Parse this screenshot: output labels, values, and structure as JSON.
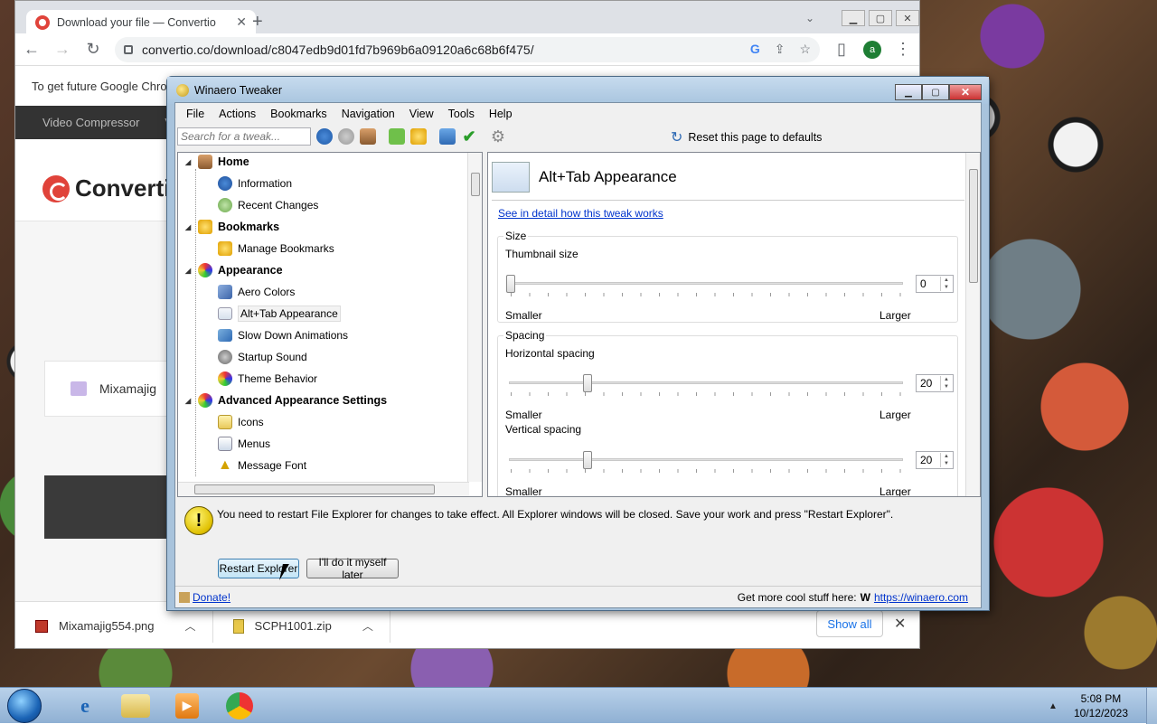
{
  "chrome": {
    "tab_title": "Download your file — Convertio",
    "tab_close": "✕",
    "new_tab": "+",
    "tab_menu": "⌄",
    "url": "convertio.co/download/c8047edb9d01fd7b969b6a09120a6c68b6f475/",
    "avatar_letter": "a",
    "notice": "To get future Google Chro",
    "site_nav": [
      "Video Compressor",
      "Vi"
    ],
    "logo_text": "Convertio",
    "file_card_name": "Mixamajig",
    "downloads": [
      {
        "name": "Mixamajig554.png"
      },
      {
        "name": "SCPH1001.zip"
      }
    ],
    "show_all": "Show all",
    "close": "✕"
  },
  "winaero": {
    "title": "Winaero Tweaker",
    "menu": [
      "File",
      "Actions",
      "Bookmarks",
      "Navigation",
      "View",
      "Tools",
      "Help"
    ],
    "search_placeholder": "Search for a tweak...",
    "reset_label": "Reset this page to defaults",
    "tree": [
      {
        "label": "Home",
        "level": 0
      },
      {
        "label": "Information",
        "level": 1
      },
      {
        "label": "Recent Changes",
        "level": 1
      },
      {
        "label": "Bookmarks",
        "level": 0
      },
      {
        "label": "Manage Bookmarks",
        "level": 1
      },
      {
        "label": "Appearance",
        "level": 0
      },
      {
        "label": "Aero Colors",
        "level": 1
      },
      {
        "label": "Alt+Tab Appearance",
        "level": 1,
        "selected": true
      },
      {
        "label": "Slow Down Animations",
        "level": 1
      },
      {
        "label": "Startup Sound",
        "level": 1
      },
      {
        "label": "Theme Behavior",
        "level": 1
      },
      {
        "label": "Advanced Appearance Settings",
        "level": 0
      },
      {
        "label": "Icons",
        "level": 1
      },
      {
        "label": "Menus",
        "level": 1
      },
      {
        "label": "Message Font",
        "level": 1
      }
    ],
    "panel": {
      "title": "Alt+Tab Appearance",
      "detail_link": "See in detail how this tweak works",
      "size_group": "Size",
      "thumbnail_label": "Thumbnail size",
      "thumbnail_value": "0",
      "spacing_group": "Spacing",
      "horizontal_label": "Horizontal spacing",
      "horizontal_value": "20",
      "vertical_label": "Vertical spacing",
      "vertical_value": "20",
      "smaller": "Smaller",
      "larger": "Larger"
    },
    "restart_message": "You need to restart File Explorer for changes to take effect. All Explorer windows will be closed. Save your work and press \"Restart Explorer\".",
    "restart_button": "Restart Explorer",
    "later_button": "I'll do it myself later",
    "donate": "Donate!",
    "more_stuff": "Get more cool stuff here:",
    "site_link": "https://winaero.com"
  },
  "taskbar": {
    "time": "5:08 PM",
    "date": "10/12/2023",
    "tray_arrow": "▲"
  }
}
